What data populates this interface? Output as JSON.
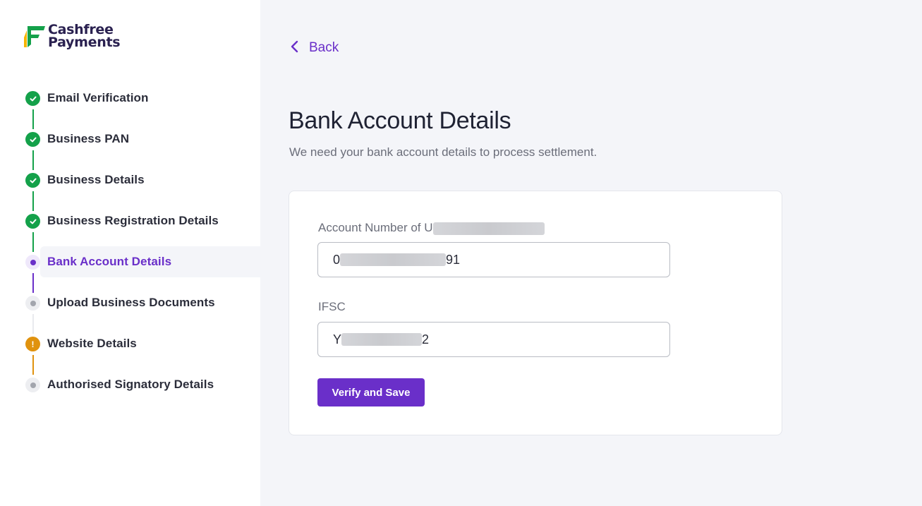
{
  "brand": {
    "line1": "Cashfree",
    "line2": "Payments"
  },
  "steps": [
    {
      "label": "Email Verification",
      "status": "done"
    },
    {
      "label": "Business PAN",
      "status": "done"
    },
    {
      "label": "Business Details",
      "status": "done"
    },
    {
      "label": "Business Registration Details",
      "status": "done"
    },
    {
      "label": "Bank Account Details",
      "status": "current"
    },
    {
      "label": "Upload Business Documents",
      "status": "pending"
    },
    {
      "label": "Website Details",
      "status": "warning"
    },
    {
      "label": "Authorised Signatory Details",
      "status": "pending"
    }
  ],
  "back_label": "Back",
  "page": {
    "title": "Bank Account Details",
    "subtitle": "We need your bank account details to process settlement."
  },
  "form": {
    "account_label_prefix": "Account Number of U",
    "account_value_prefix": "0",
    "account_value_suffix": "91",
    "ifsc_label": "IFSC",
    "ifsc_value_prefix": "Y",
    "ifsc_value_suffix": "2",
    "submit_label": "Verify and Save"
  },
  "colors": {
    "accent": "#6a2fc9",
    "done": "#14a14a",
    "warning": "#e0920e",
    "pending": "#a2a5ad"
  },
  "icons": {
    "done": "check-icon",
    "current": "dot-icon",
    "pending": "dot-icon",
    "warning": "exclamation-icon",
    "back": "chevron-left-icon"
  }
}
